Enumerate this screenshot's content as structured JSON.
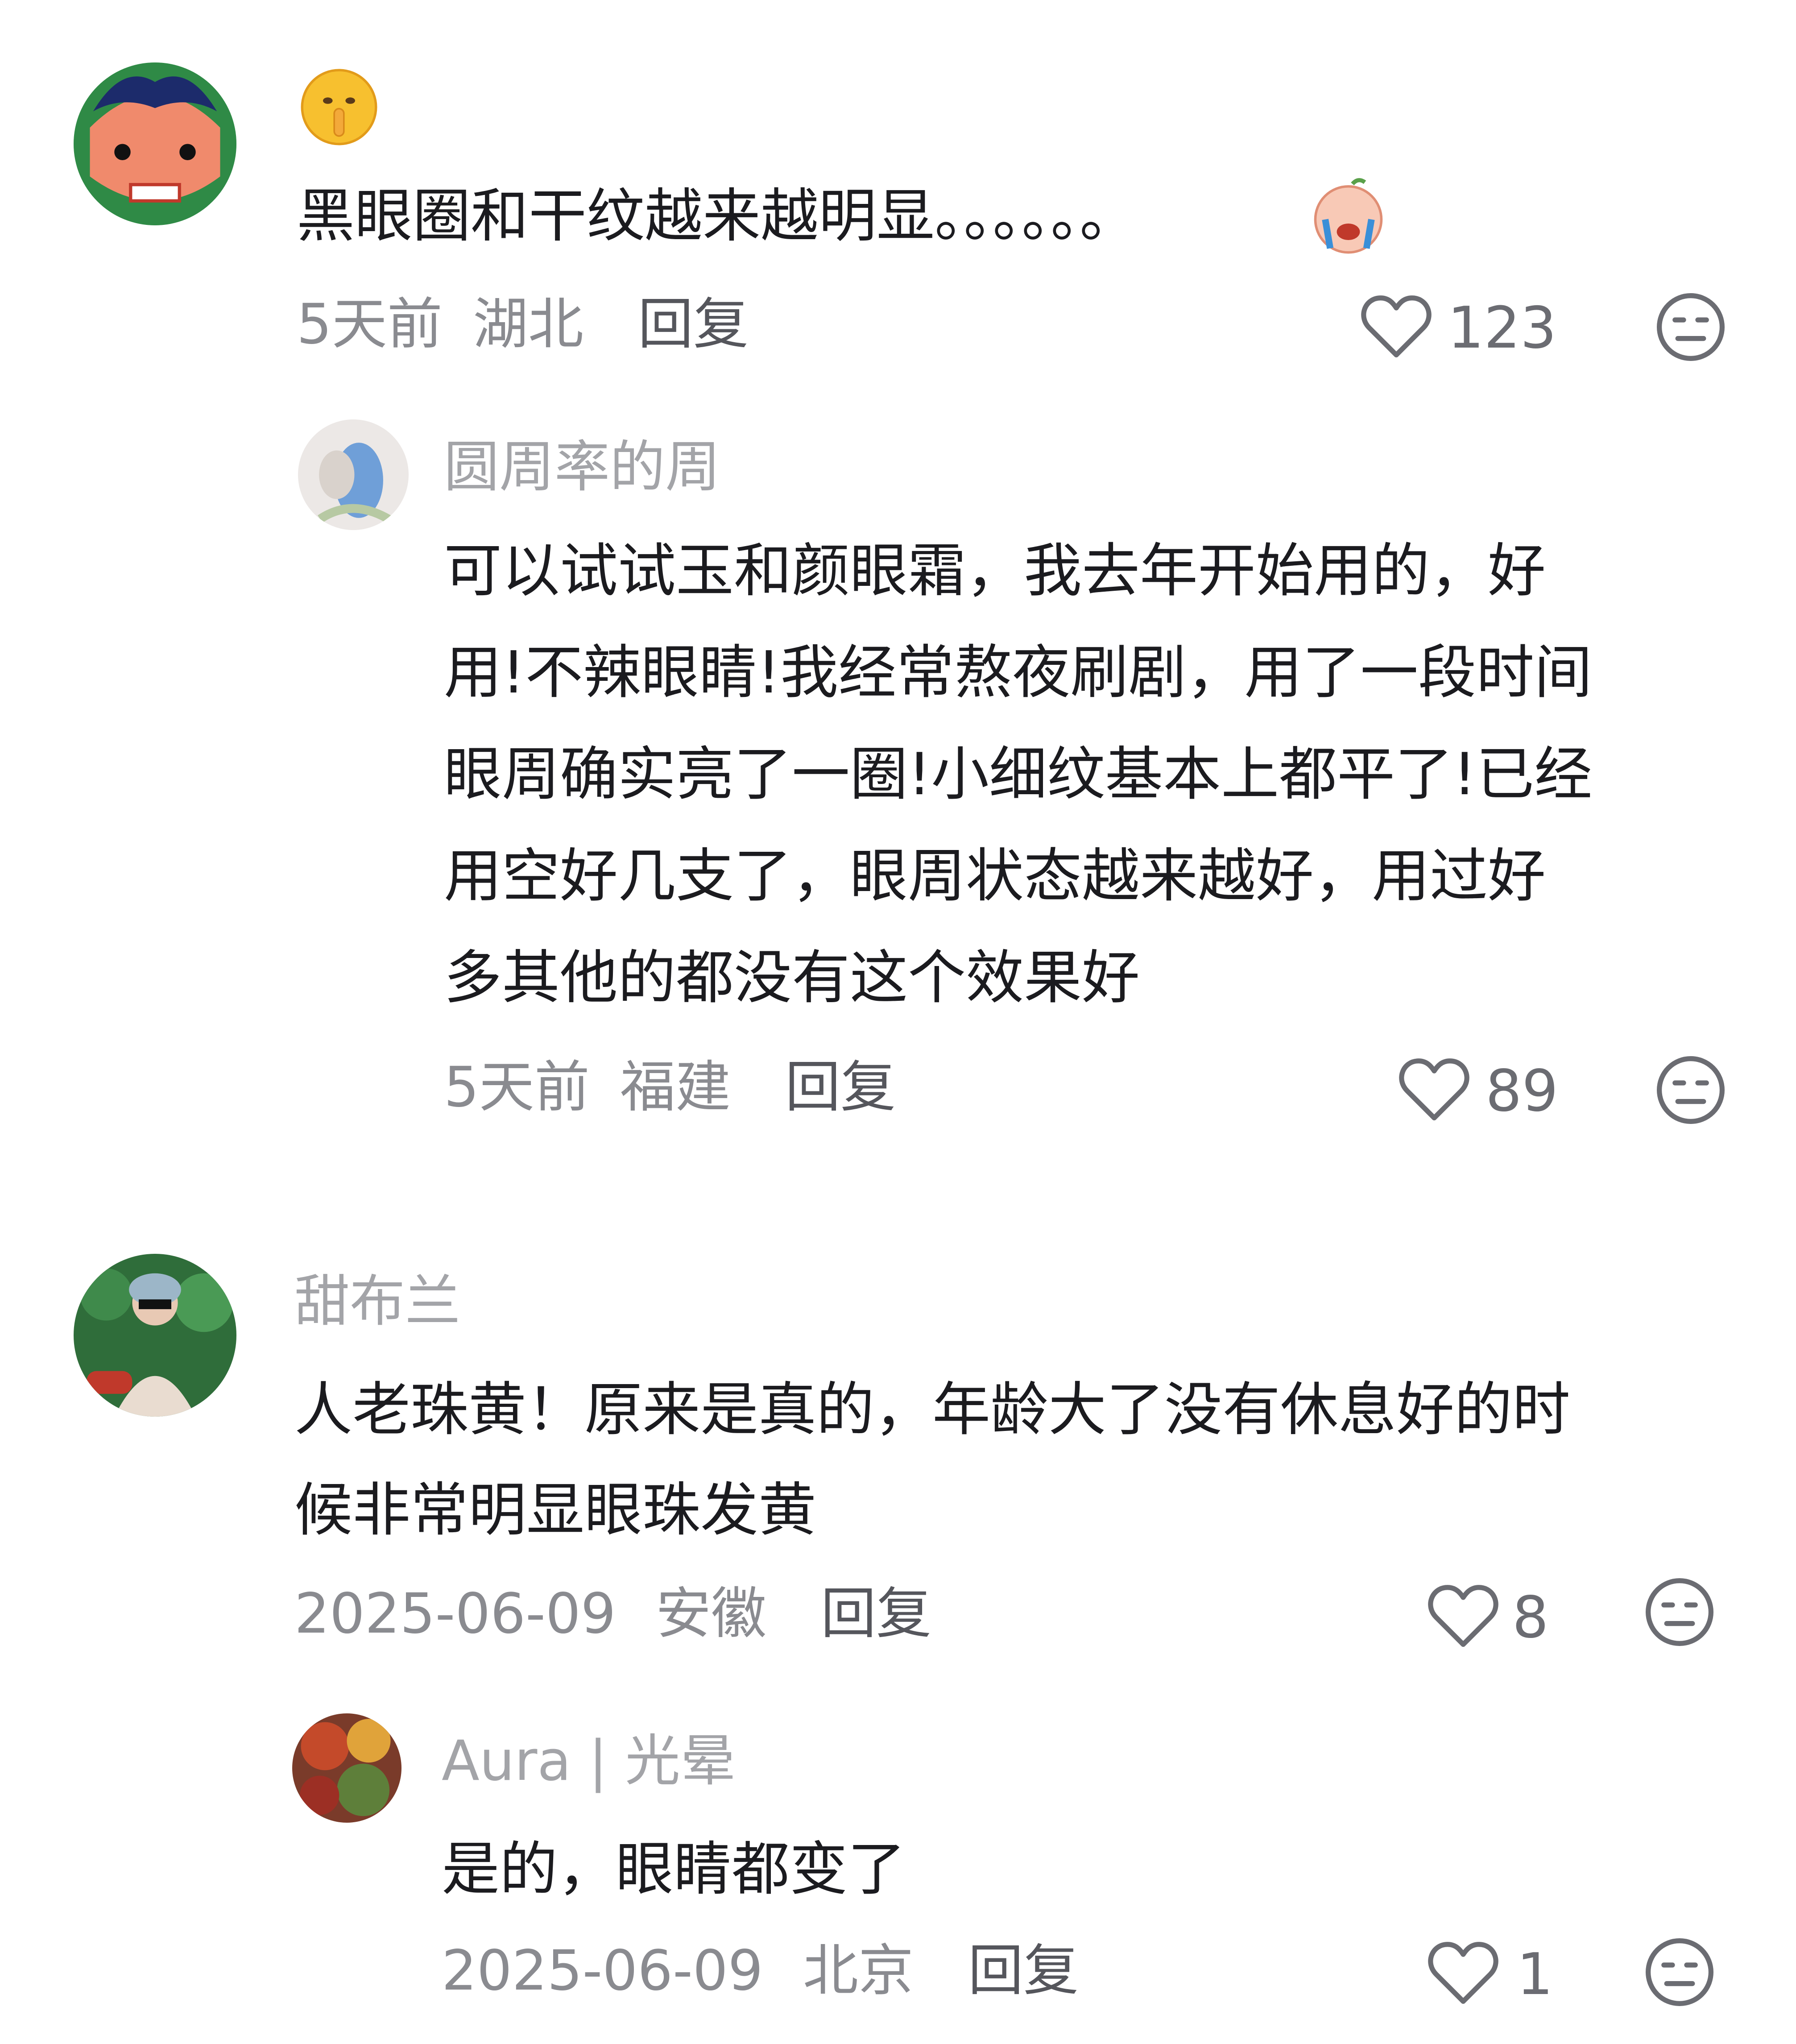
{
  "comments": [
    {
      "username": "",
      "avatar_icon": "cartoon-face-avatar",
      "emoji_line_icon": "shushing-face-emoji",
      "text_lines": [
        "黑眼圈和干纹越来越明显。。。。。。"
      ],
      "trailing_emoji_icon": "crying-face-emoji",
      "time": "5天前",
      "location": "湖北",
      "reply_label": "回复",
      "likes": "123",
      "reply": {
        "username": "圆周率的周",
        "avatar_icon": "bird-photo-avatar",
        "text_lines": [
          "可以试试玉和颜眼霜，我去年开始用的，好",
          "用!不辣眼睛!我经常熬夜刷剧，用了一段时间",
          "眼周确实亮了一圈!小细纹基本上都平了!已经",
          "用空好几支了，眼周状态越来越好，用过好",
          "多其他的都没有这个效果好"
        ],
        "time": "5天前",
        "location": "福建",
        "reply_label": "回复",
        "likes": "89"
      }
    },
    {
      "username": "甜布兰",
      "avatar_icon": "person-photo-avatar",
      "text_lines": [
        "人老珠黄！原来是真的，年龄大了没有休息好的时",
        "候非常明显眼珠发黄"
      ],
      "time": "2025-06-09",
      "location": "安徽",
      "reply_label": "回复",
      "likes": "8",
      "reply": {
        "username": "Aura | 光晕",
        "avatar_icon": "autumn-leaves-avatar",
        "text_lines": [
          "是的，眼睛都变了"
        ],
        "time": "2025-06-09",
        "location": "北京",
        "reply_label": "回复",
        "likes": "1"
      }
    }
  ],
  "icons": {
    "like": "heart-outline-icon",
    "dislike": "meh-face-icon"
  },
  "colors": {
    "body_text": "#1b1b1f",
    "name": "#a3a4a8",
    "meta": "#8a8b90"
  }
}
